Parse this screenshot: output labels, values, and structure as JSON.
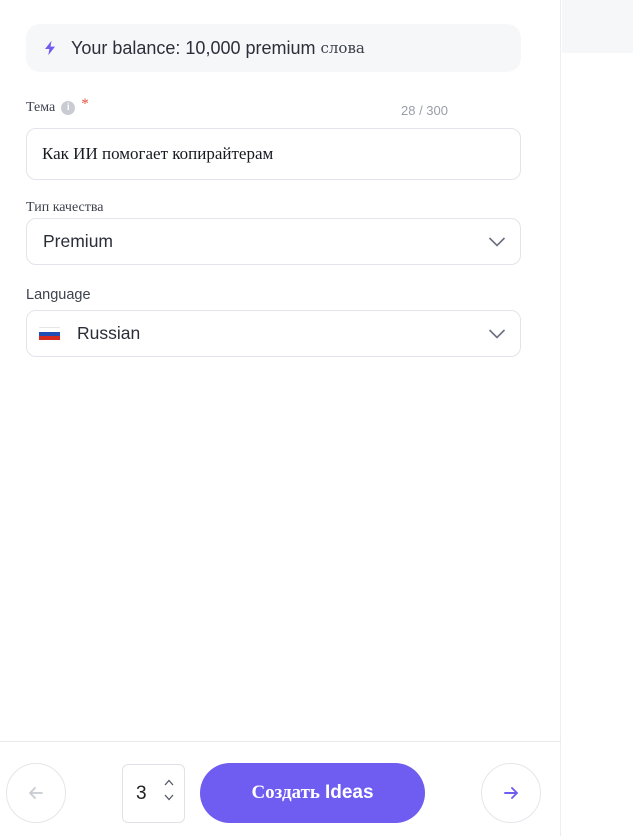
{
  "balance": {
    "text": "Your balance: 10,000 premium",
    "unit": "слова",
    "icon": "lightning-icon",
    "accent": "#6f5cf1"
  },
  "topic": {
    "label": "Тема",
    "required_mark": "*",
    "counter": "28 / 300",
    "value": "Как ИИ помогает копирайтерам"
  },
  "quality": {
    "label": "Тип качества",
    "selected": "Premium"
  },
  "language": {
    "label": "Language",
    "selected": "Russian",
    "flag": "russia-flag-icon"
  },
  "footer": {
    "count_value": "3",
    "create_label_ru": "Создать",
    "create_label_en": "Ideas",
    "button_color": "#6f5cf1"
  }
}
